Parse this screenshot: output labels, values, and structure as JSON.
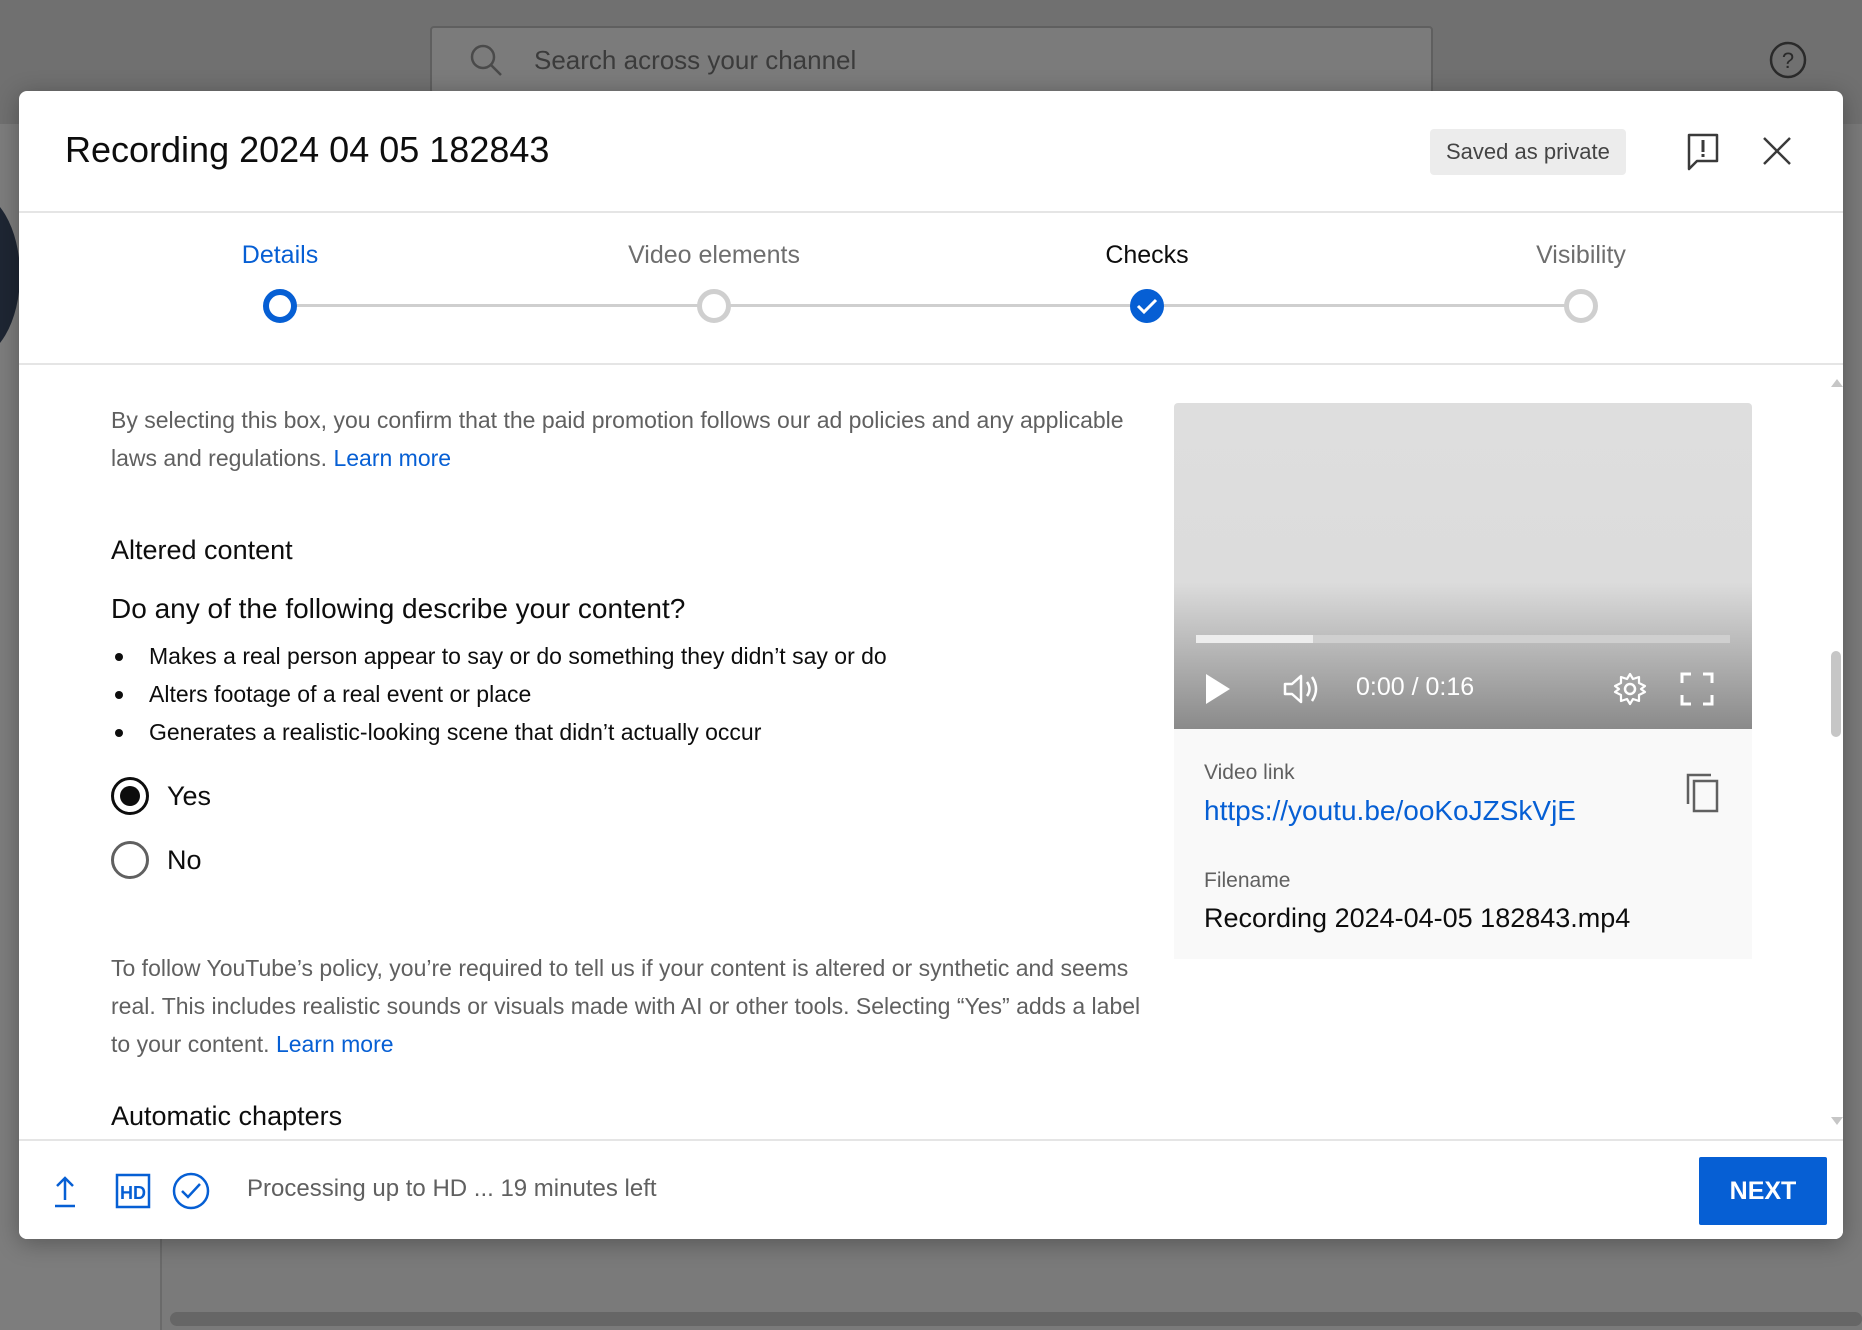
{
  "background": {
    "search_placeholder": "Search across your channel"
  },
  "modal": {
    "title": "Recording 2024 04 05 182843",
    "saved_badge": "Saved as private"
  },
  "stepper": {
    "steps": [
      {
        "label": "Details",
        "state": "active"
      },
      {
        "label": "Video elements",
        "state": "pending"
      },
      {
        "label": "Checks",
        "state": "done"
      },
      {
        "label": "Visibility",
        "state": "pending"
      }
    ]
  },
  "content": {
    "promo_text": "By selecting this box, you confirm that the paid promotion follows our ad policies and any applicable laws and regulations.",
    "promo_link": "Learn more",
    "altered_title": "Altered content",
    "question": "Do any of the following describe your content?",
    "bullets": [
      "Makes a real person appear to say or do something they didn’t say or do",
      "Alters footage of a real event or place",
      "Generates a realistic-looking scene that didn’t actually occur"
    ],
    "options": [
      {
        "label": "Yes",
        "selected": true
      },
      {
        "label": "No",
        "selected": false
      }
    ],
    "policy_text": "To follow YouTube’s policy, you’re required to tell us if your content is altered or synthetic and seems real. This includes realistic sounds or visuals made with AI or other tools. Selecting “Yes” adds a label to your content.",
    "policy_link": "Learn more",
    "next_section": "Automatic chapters"
  },
  "video": {
    "time": "0:00 / 0:16",
    "buffered_fraction": 0.22,
    "link_label": "Video link",
    "link": "https://youtu.be/ooKoJZSkVjE",
    "filename_label": "Filename",
    "filename": "Recording 2024-04-05 182843.mp4"
  },
  "footer": {
    "status": "Processing up to HD ... 19 minutes left",
    "hd_label": "HD",
    "next_label": "NEXT"
  },
  "colors": {
    "accent": "#065fd4",
    "text": "#0d0d0d",
    "secondary_text": "#606060"
  }
}
